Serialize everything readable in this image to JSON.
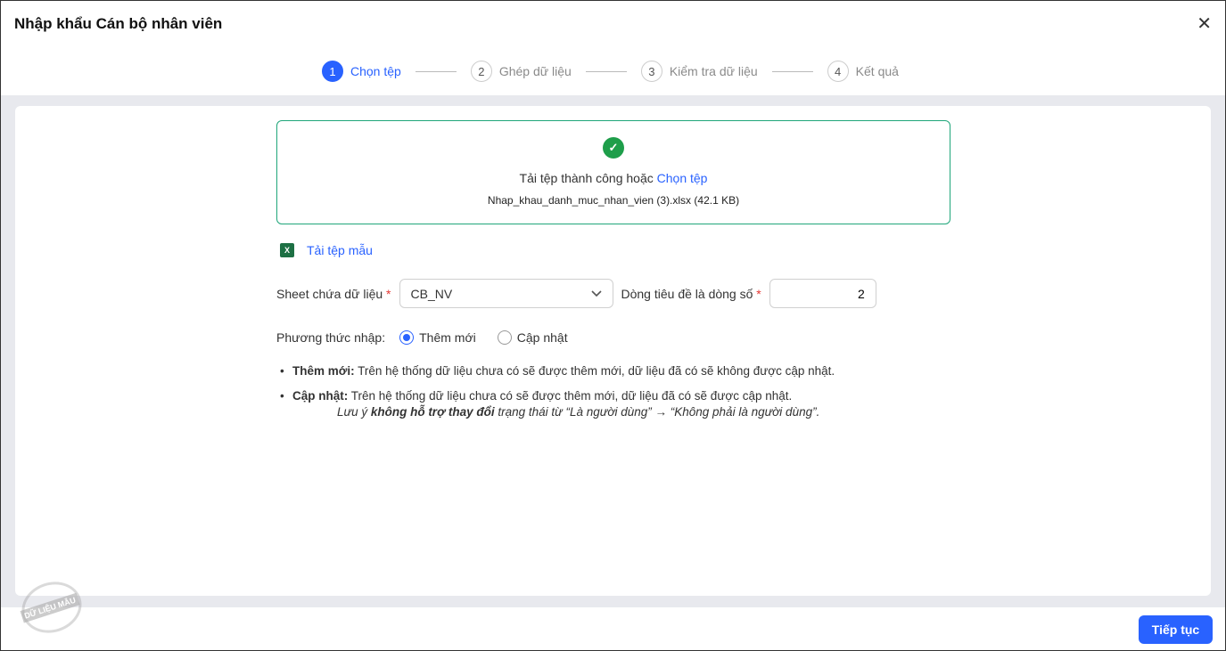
{
  "header": {
    "title": "Nhập khẩu Cán bộ nhân viên",
    "close": "✕"
  },
  "steps": [
    {
      "num": "1",
      "label": "Chọn tệp"
    },
    {
      "num": "2",
      "label": "Ghép dữ liệu"
    },
    {
      "num": "3",
      "label": "Kiểm tra dữ liệu"
    },
    {
      "num": "4",
      "label": "Kết quả"
    }
  ],
  "upload": {
    "status": "Tải tệp thành công hoặc ",
    "choose": "Chọn tệp",
    "file": "Nhap_khau_danh_muc_nhan_vien (3).xlsx (42.1 KB)"
  },
  "template_link": "Tải tệp mẫu",
  "form": {
    "sheet_label": "Sheet chứa dữ liệu",
    "sheet_value": "CB_NV",
    "header_row_label": "Dòng tiêu đề là dòng số",
    "header_row_value": "2",
    "required": "*"
  },
  "method": {
    "label": "Phương thức nhập:",
    "options": [
      "Thêm mới",
      "Cập nhật"
    ],
    "selected": "Thêm mới"
  },
  "notes": {
    "add_title": "Thêm mới:",
    "add_text": " Trên hệ thống dữ liệu chưa có sẽ được thêm mới, dữ liệu đã có sẽ không được cập nhật.",
    "update_title": "Cập nhật:",
    "update_text": " Trên hệ thống dữ liệu chưa có sẽ được thêm mới, dữ liệu đã có sẽ được cập nhật.",
    "warn_pre": "Lưu ý ",
    "warn_bold": "không hỗ trợ thay đổi",
    "warn_post": " trạng thái từ “Là người dùng” → “Không phải là người dùng”."
  },
  "footer": {
    "next": "Tiếp tục"
  },
  "watermark": "DỮ LIỆU MẪU"
}
